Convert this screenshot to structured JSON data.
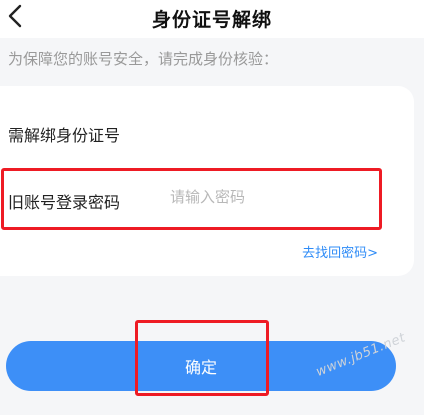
{
  "nav": {
    "title": "身份证号解绑",
    "back_icon": "chevron-left-icon"
  },
  "hint": "为保障您的账号安全，请完成身份核验：",
  "form": {
    "idcard_label": "需解绑身份证号",
    "password_label": "旧账号登录密码",
    "password_placeholder": "请输入密码",
    "forgot_link": "去找回密码>"
  },
  "confirm_label": "确定",
  "watermark": "www.jb51.net",
  "colors": {
    "accent": "#3d8ff7",
    "link": "#2f8cf7",
    "highlight": "#ee1b24"
  }
}
